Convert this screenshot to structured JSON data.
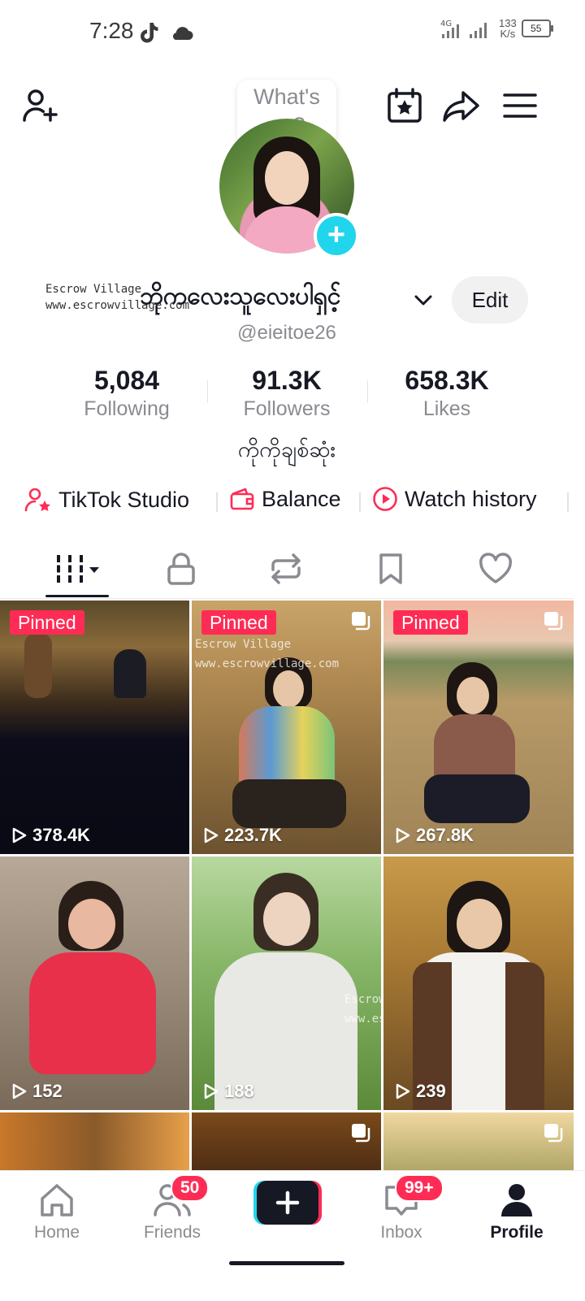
{
  "status_bar": {
    "time": "7:28",
    "network": "4G",
    "speed_value": "133",
    "speed_unit": "K/s",
    "battery": "55"
  },
  "header": {
    "status_bubble": "What's up?"
  },
  "profile": {
    "watermark_line1": "Escrow Village",
    "watermark_line2": "www.escrowvillage.com",
    "display_name": "ဘိုကလေးသူလေးပါရှင့်",
    "edit_label": "Edit",
    "username": "@eieitoe26",
    "bio": "ကိုကိုချစ်ဆုံး"
  },
  "stats": [
    {
      "value": "5,084",
      "label": "Following"
    },
    {
      "value": "91.3K",
      "label": "Followers"
    },
    {
      "value": "658.3K",
      "label": "Likes"
    }
  ],
  "shortcuts": [
    {
      "label": "TikTok Studio",
      "icon": "person-star-icon"
    },
    {
      "label": "Balance",
      "icon": "wallet-icon"
    },
    {
      "label": "Watch history",
      "icon": "play-circle-icon"
    }
  ],
  "tabs": [
    {
      "name": "videos",
      "icon": "grid-bars-icon",
      "active": true
    },
    {
      "name": "private",
      "icon": "lock-icon"
    },
    {
      "name": "reposts",
      "icon": "repost-icon"
    },
    {
      "name": "favorites",
      "icon": "bookmark-icon"
    },
    {
      "name": "liked",
      "icon": "heart-icon"
    }
  ],
  "videos": [
    {
      "pinned_label": "Pinned",
      "views": "378.4K"
    },
    {
      "pinned_label": "Pinned",
      "views": "223.7K",
      "watermark1": "Escrow Village",
      "watermark2": "www.escrowvillage.com"
    },
    {
      "pinned_label": "Pinned",
      "views": "267.8K"
    },
    {
      "views": "152"
    },
    {
      "views": "188",
      "watermark1": "Escrow Village",
      "watermark2": "www.escrowvillage.com"
    },
    {
      "views": "239"
    }
  ],
  "bottom_nav": {
    "home": "Home",
    "friends": "Friends",
    "friends_badge": "50",
    "inbox": "Inbox",
    "inbox_badge": "99+",
    "profile": "Profile"
  },
  "colors": {
    "accent": "#fe2c55",
    "cyan": "#20d5ec",
    "text": "#161823",
    "muted": "#8a8b91"
  }
}
